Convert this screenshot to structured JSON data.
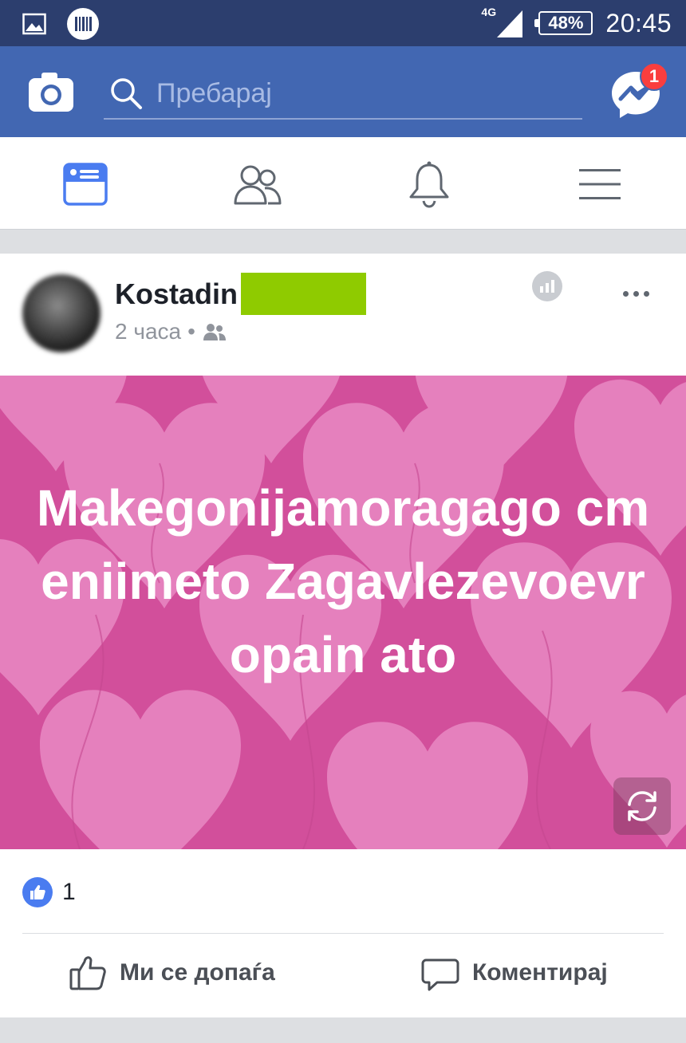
{
  "status_bar": {
    "network": "4G",
    "battery": "48%",
    "time": "20:45"
  },
  "header": {
    "search_placeholder": "Пребарај",
    "messenger_badge": "1"
  },
  "tabs": [
    "news-feed",
    "friends",
    "notifications",
    "menu"
  ],
  "post": {
    "author": "Kostadin",
    "time": "2 часа",
    "separator": "•",
    "text": "Makegonijamoragago cmeniimeto Zagavlezevoevropain ato",
    "like_count": "1",
    "actions": {
      "like": "Ми се допаѓа",
      "comment": "Коментирај"
    }
  },
  "colors": {
    "header": "#4267b2",
    "status_bar": "#2c3e6e",
    "post_background": "#d24f9b",
    "redaction": "#8fcb00"
  }
}
